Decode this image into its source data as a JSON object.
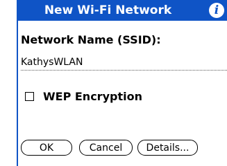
{
  "dialog": {
    "title": "New Wi-Fi Network",
    "info_icon": "i",
    "ssid_label": "Network Name (SSID):",
    "ssid_value": "KathysWLAN",
    "wep": {
      "label": "WEP Encryption",
      "checked": false
    }
  },
  "buttons": {
    "ok": "OK",
    "cancel": "Cancel",
    "details": "Details..."
  },
  "colors": {
    "titlebar": "#0f54c6",
    "background": "#ffffff"
  },
  "icons": {
    "info": "info-icon"
  }
}
